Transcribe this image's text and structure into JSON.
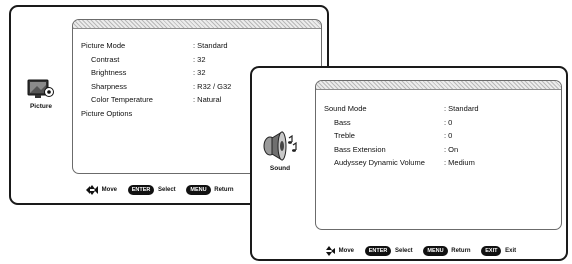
{
  "picture_menu": {
    "icon_label": "Picture",
    "rows": [
      {
        "label": "Picture Mode",
        "value": ": Standard"
      },
      {
        "label": "Contrast",
        "value": ": 32"
      },
      {
        "label": "Brightness",
        "value": ": 32"
      },
      {
        "label": "Sharpness",
        "value": ": R32 / G32"
      },
      {
        "label": "Color Temperature",
        "value": ": Natural"
      },
      {
        "label": "Picture Options",
        "value": ""
      }
    ],
    "footer": {
      "move_label": "Move",
      "enter_key": "ENTER",
      "select_label": "Select",
      "menu_key": "MENU",
      "return_label": "Return"
    }
  },
  "sound_menu": {
    "icon_label": "Sound",
    "rows": [
      {
        "label": "Sound Mode",
        "value": ": Standard"
      },
      {
        "label": "Bass",
        "value": ": 0"
      },
      {
        "label": "Treble",
        "value": ": 0"
      },
      {
        "label": "Bass Extension",
        "value": ": On"
      },
      {
        "label": "Audyssey Dynamic Volume",
        "value": ": Medium"
      }
    ],
    "footer": {
      "move_label": "Move",
      "enter_key": "ENTER",
      "select_label": "Select",
      "menu_key": "MENU",
      "return_label": "Return",
      "exit_key": "EXIT",
      "exit_label": "Exit"
    }
  },
  "icons": {
    "picture": "tv-picture-icon",
    "sound": "speaker-sound-icon",
    "arrows": "navigation-arrows-icon"
  }
}
